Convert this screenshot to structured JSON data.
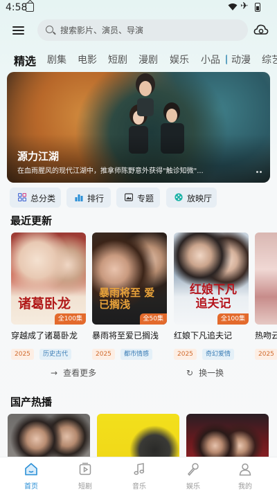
{
  "status_bar": {
    "time": "4:58"
  },
  "search": {
    "placeholder": "搜索影片、演员、导演"
  },
  "tabs": [
    {
      "label": "精选",
      "active": true
    },
    {
      "label": "剧集"
    },
    {
      "label": "电影"
    },
    {
      "label": "短剧"
    },
    {
      "label": "漫剧"
    },
    {
      "label": "娱乐"
    },
    {
      "label": "小品"
    },
    {
      "label": "动漫"
    },
    {
      "label": "综艺"
    }
  ],
  "banner": {
    "title": "源力江湖",
    "description": "在血雨腥风的现代江湖中，推拿师陈野意外获得\"触诊知微\"..."
  },
  "quick_links": [
    {
      "label": "总分类",
      "icon": "grid-icon"
    },
    {
      "label": "排行",
      "icon": "bar-chart-icon"
    },
    {
      "label": "专题",
      "icon": "image-icon"
    },
    {
      "label": "放映厅",
      "icon": "film-reel-icon"
    }
  ],
  "recent": {
    "title": "最近更新",
    "items": [
      {
        "title": "穿越成了诸葛卧龙",
        "poster_text": "诸葛卧龙",
        "badge": "全100集",
        "year": "2025",
        "genre": "历史古代"
      },
      {
        "title": "暴雨将至爱已搁浅",
        "poster_text": "暴雨将至 爱已搁浅",
        "badge": "全50集",
        "year": "2025",
        "genre": "都市情感"
      },
      {
        "title": "红娘下凡追夫记",
        "poster_text": "红娘下凡 追夫记",
        "badge": "全100集",
        "year": "2025",
        "genre": "奇幻爱情"
      },
      {
        "title": "热吻云",
        "year": "2025"
      }
    ],
    "more_label": "查看更多",
    "swap_label": "换一换"
  },
  "hot": {
    "title": "国产热播"
  },
  "bottom_nav": [
    {
      "label": "首页",
      "icon": "home-icon",
      "active": true
    },
    {
      "label": "短剧",
      "icon": "play-square-icon"
    },
    {
      "label": "音乐",
      "icon": "music-note-icon"
    },
    {
      "label": "娱乐",
      "icon": "microphone-icon"
    },
    {
      "label": "我的",
      "icon": "user-icon"
    }
  ],
  "colors": {
    "accent": "#2a8fd6",
    "badge": "#e36a2c",
    "year_tag": "#d06a2c",
    "genre_tag": "#3a7cb5"
  }
}
